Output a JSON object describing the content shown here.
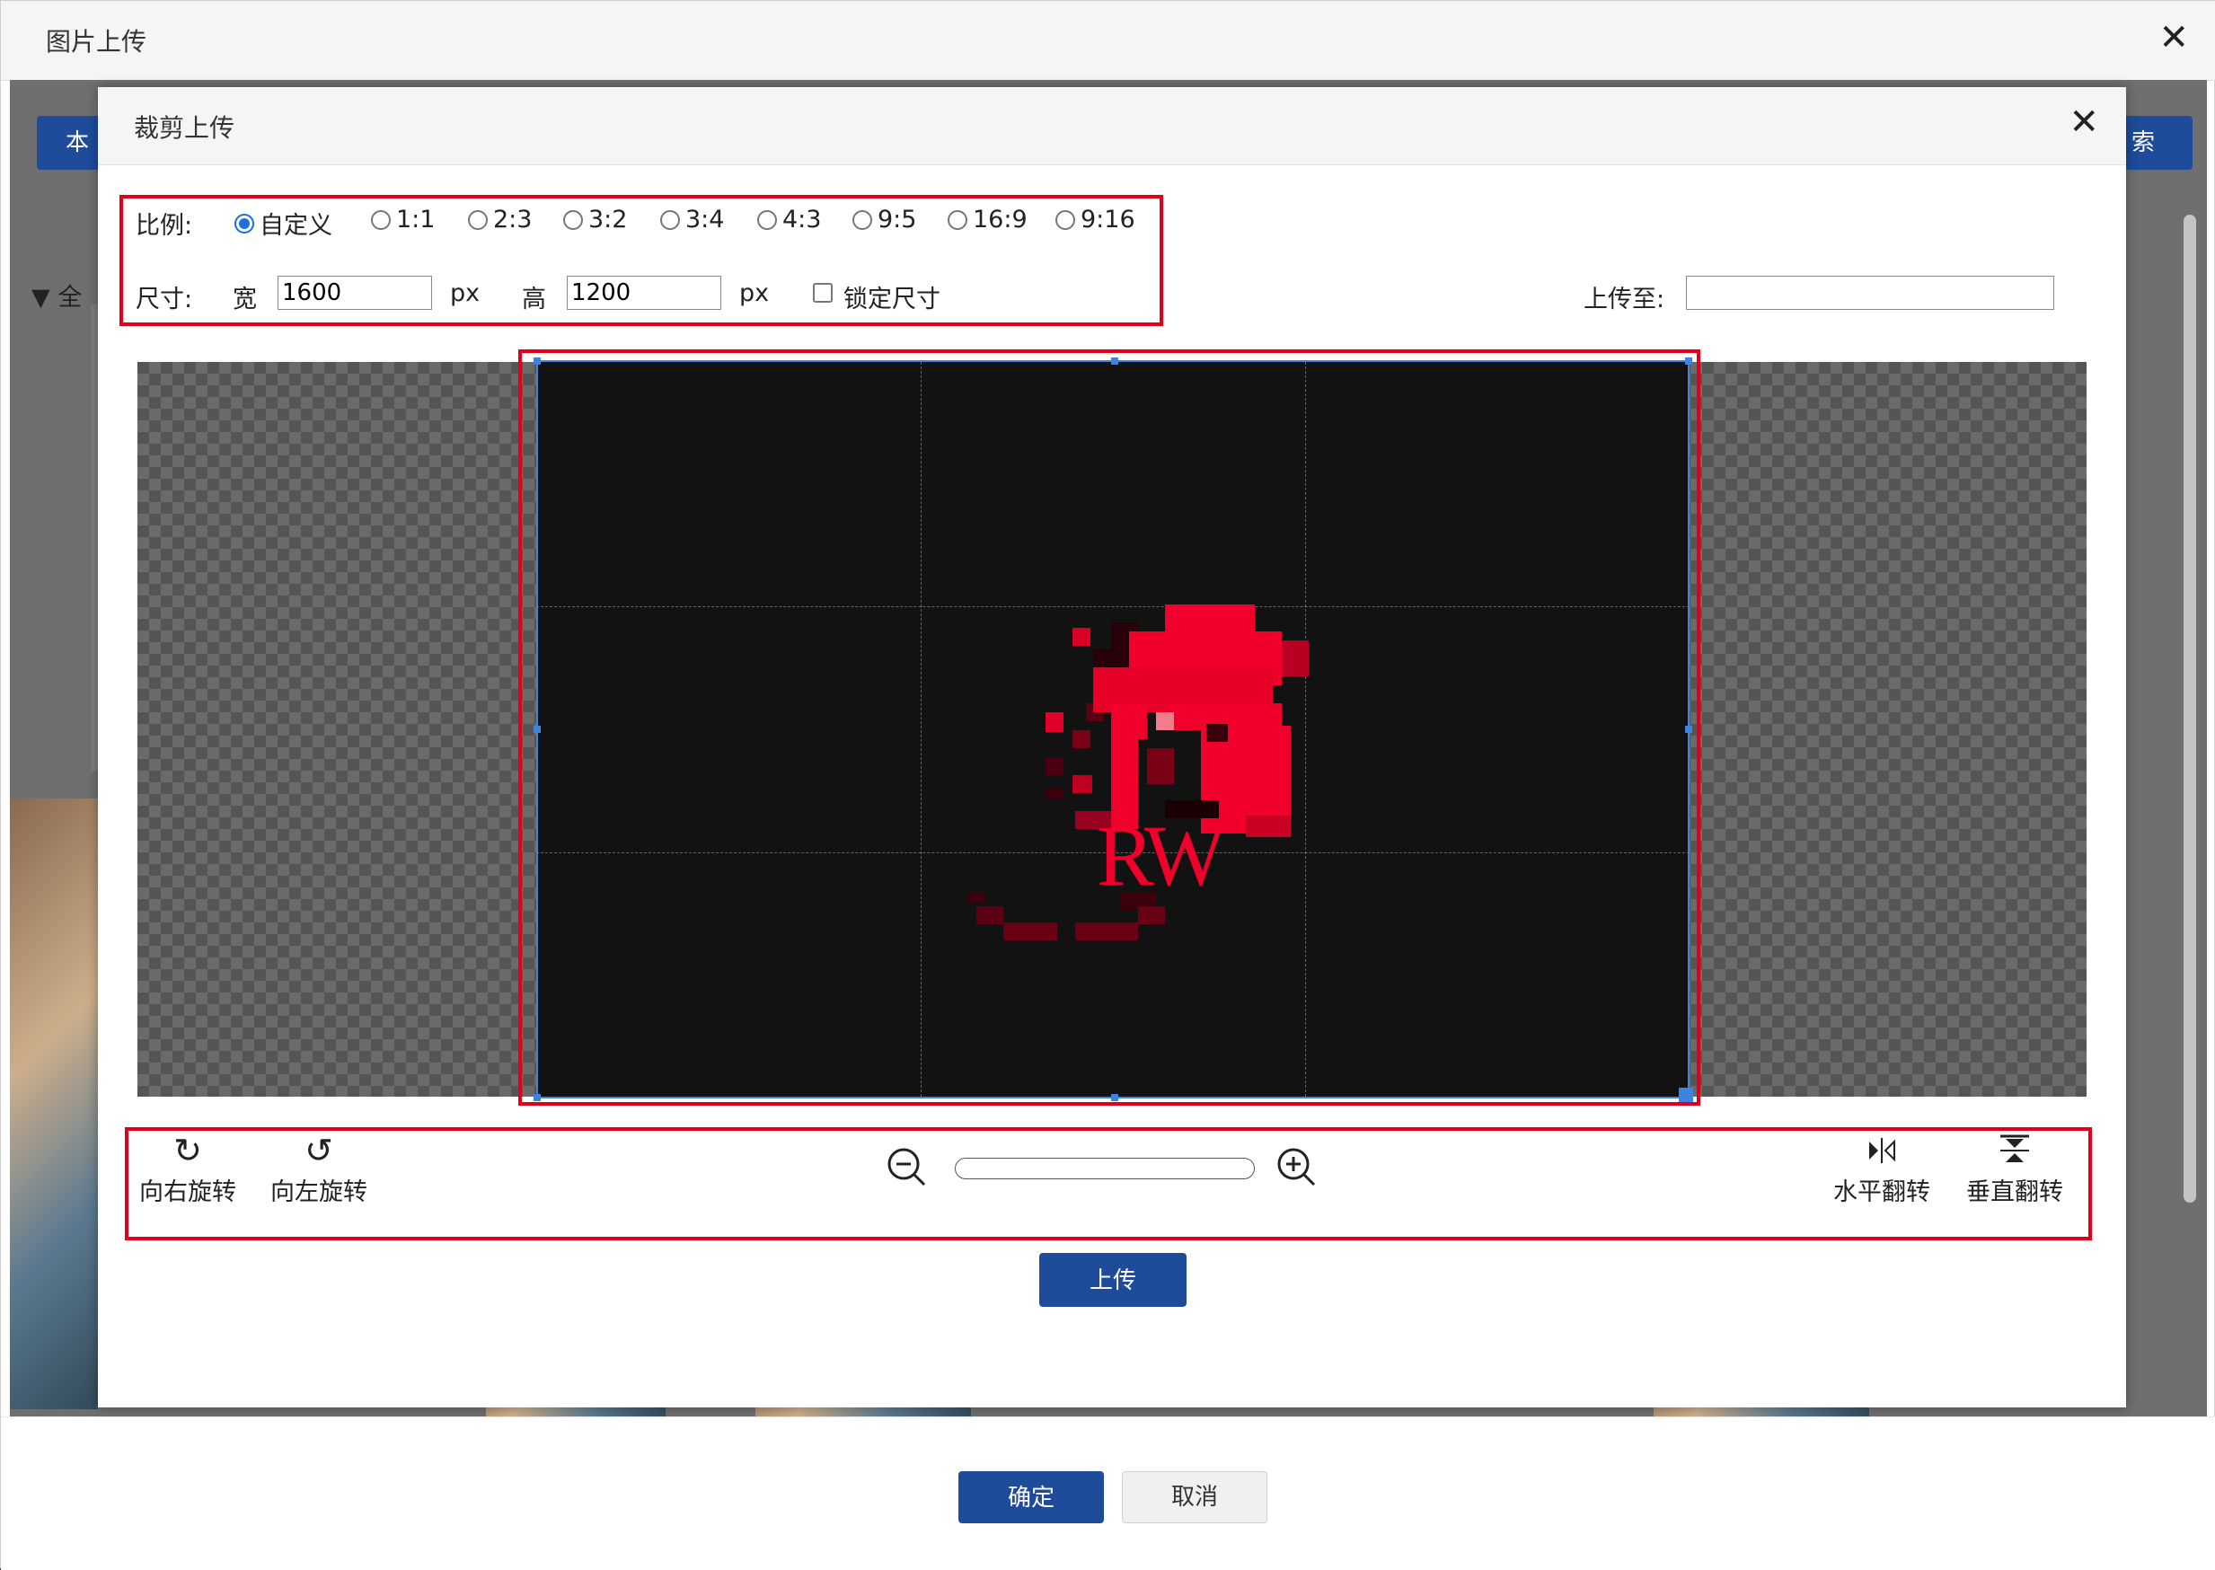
{
  "outer_dialog": {
    "title": "图片上传",
    "confirm_label": "确定",
    "cancel_label": "取消"
  },
  "background": {
    "left_button_text": "本",
    "right_button_text": "索",
    "tree_label": "全"
  },
  "crop_dialog": {
    "title": "裁剪上传",
    "ratio_label": "比例:",
    "ratios": [
      "自定义",
      "1:1",
      "2:3",
      "3:2",
      "3:4",
      "4:3",
      "9:5",
      "16:9",
      "9:16"
    ],
    "selected_ratio": "自定义",
    "size_label": "尺寸:",
    "width_label": "宽",
    "width_value": "1600",
    "width_unit": "px",
    "height_label": "高",
    "height_value": "1200",
    "height_unit": "px",
    "lock_label": "锁定尺寸",
    "lock_checked": false,
    "upload_to_label": "上传至:",
    "upload_to_value": "",
    "image_text": "RW",
    "rotate_right_label": "向右旋转",
    "rotate_left_label": "向左旋转",
    "flip_h_label": "水平翻转",
    "flip_v_label": "垂直翻转",
    "zoom_level": 0,
    "upload_button": "上传",
    "accent_color": "#1e4b9a",
    "highlight_color": "#e1001b",
    "crop_frame_color": "#3d84e0",
    "logo_color": "#f0002a"
  },
  "icons": {
    "close": "close-icon",
    "rotate_right": "rotate-right-icon",
    "rotate_left": "rotate-left-icon",
    "zoom_out": "zoom-out-icon",
    "zoom_in": "zoom-in-icon",
    "flip_h": "flip-horizontal-icon",
    "flip_v": "flip-vertical-icon"
  }
}
